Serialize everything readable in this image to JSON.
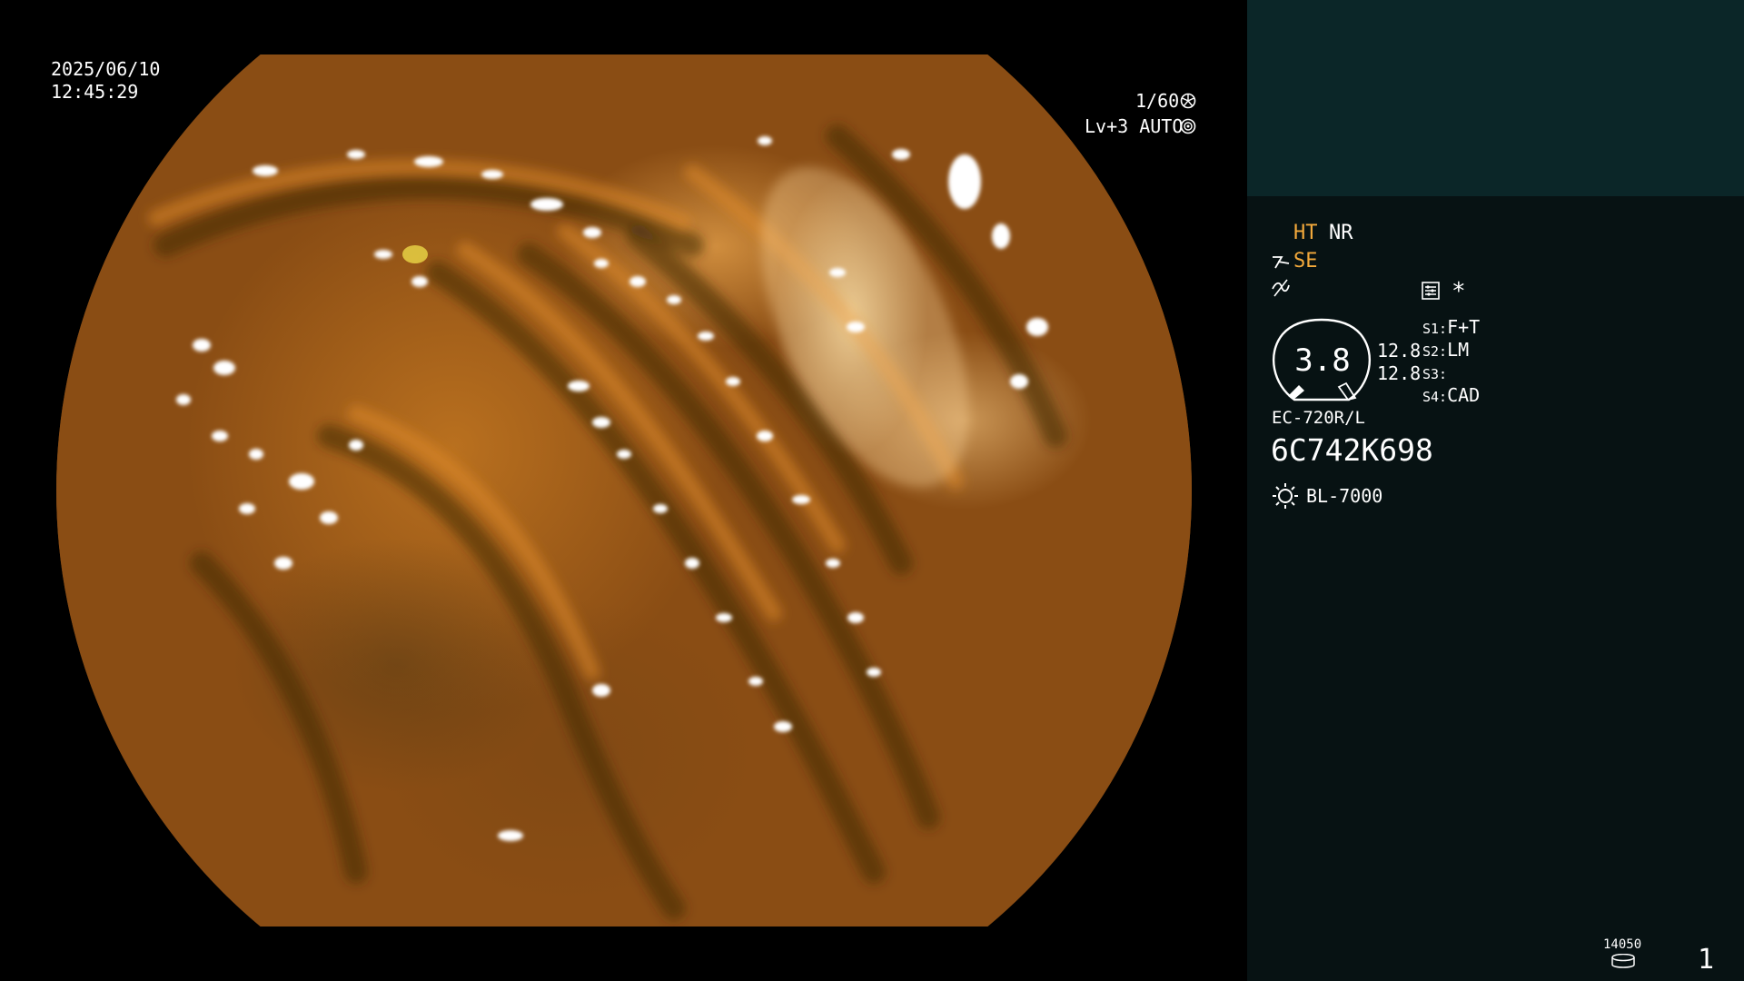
{
  "osd": {
    "date": "2025/06/10",
    "time": "12:45:29",
    "shutter": "1/60",
    "level_mode": "Lv+3 AUTO"
  },
  "panel": {
    "ht_label": "HT",
    "nr_label": "NR",
    "se_label": "SE",
    "zoom_value": "3.8",
    "value_a": "12.8",
    "value_b": "12.8",
    "switches": [
      {
        "key": "S1:",
        "value": "F+T"
      },
      {
        "key": "S2:",
        "value": "LM"
      },
      {
        "key": "S3:",
        "value": ""
      },
      {
        "key": "S4:",
        "value": "CAD"
      }
    ],
    "scope_model": "EC-720R/L",
    "serial_number": "6C742K698",
    "light_source": "BL-7000",
    "storage_count": "14050",
    "page_number": "1"
  },
  "colors": {
    "panel_top": "#0b2628",
    "panel_bottom": "#071213",
    "amber_text": "#f3a93b"
  },
  "icons": [
    "shutter-icon",
    "iris-icon",
    "scope-angle-icon",
    "wave-icon",
    "settings-list-icon",
    "asterisk-icon",
    "light-source-icon",
    "disk-icon"
  ]
}
